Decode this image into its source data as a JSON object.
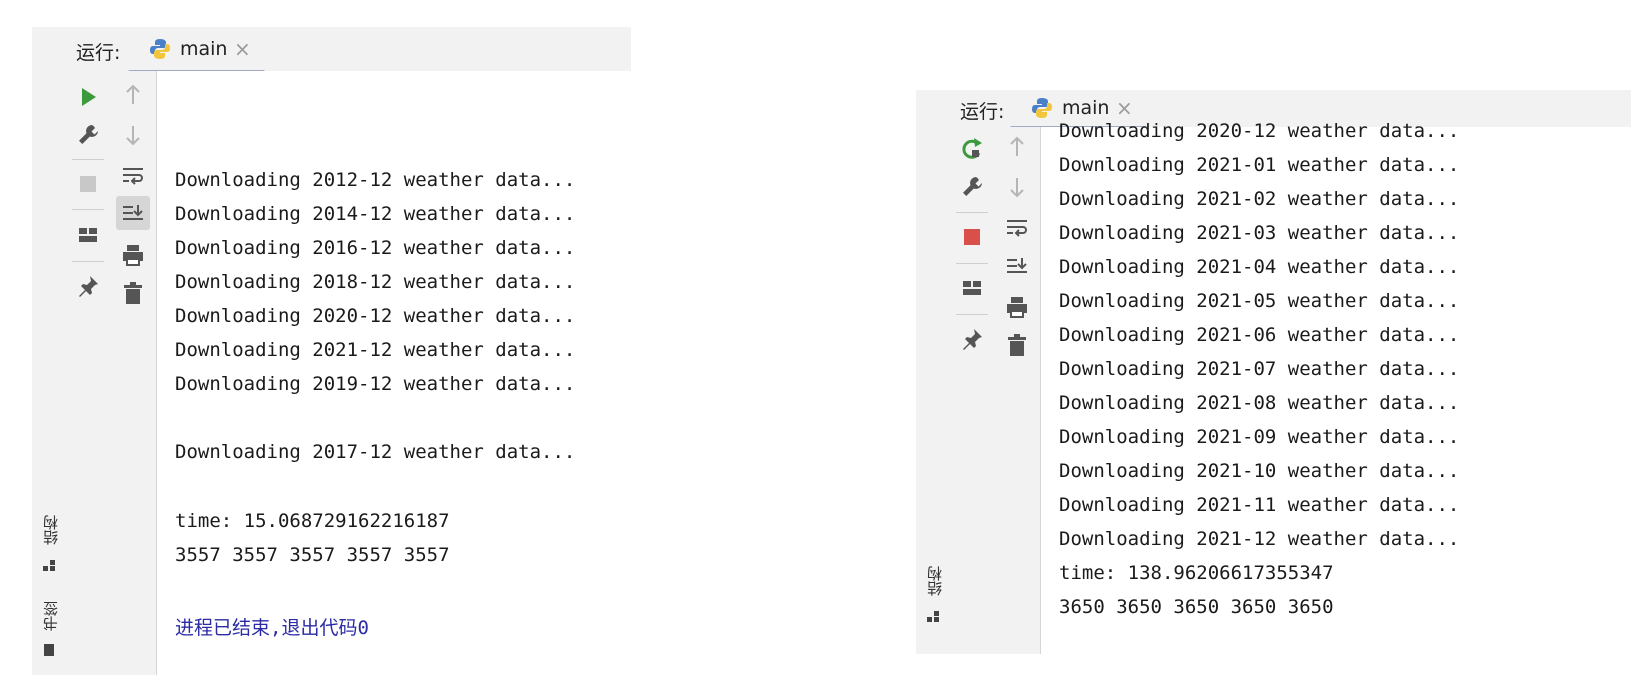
{
  "left_panel": {
    "run_label": "运行:",
    "tab_label": "main",
    "tab_close": "×",
    "side_labels": {
      "structure": "结构",
      "bookmarks": "书签"
    },
    "console_lines": [
      "Downloading 2012-12 weather data...",
      "Downloading 2014-12 weather data...",
      "Downloading 2016-12 weather data...",
      "Downloading 2018-12 weather data...",
      "Downloading 2020-12 weather data...",
      "Downloading 2021-12 weather data...",
      "Downloading 2019-12 weather data...",
      "",
      "Downloading 2017-12 weather data...",
      "",
      "time: 15.068729162216187",
      "3557 3557 3557 3557 3557",
      "",
      "进程已结束,退出代码0"
    ],
    "toolbar_icons": [
      "run-icon",
      "wrench-icon",
      "stop-icon",
      "layout-icon",
      "pin-icon"
    ],
    "toolbar2_icons": [
      "arrow-up-icon",
      "arrow-down-icon",
      "soft-wrap-icon",
      "scroll-to-end-icon",
      "print-icon",
      "trash-icon"
    ]
  },
  "right_panel": {
    "run_label": "运行:",
    "tab_label": "main",
    "tab_close": "×",
    "side_labels": {
      "structure": "结构"
    },
    "console_lines": [
      "Downloading 2020-12 weather data...",
      "Downloading 2021-01 weather data...",
      "Downloading 2021-02 weather data...",
      "Downloading 2021-03 weather data...",
      "Downloading 2021-04 weather data...",
      "Downloading 2021-05 weather data...",
      "Downloading 2021-06 weather data...",
      "Downloading 2021-07 weather data...",
      "Downloading 2021-08 weather data...",
      "Downloading 2021-09 weather data...",
      "Downloading 2021-10 weather data...",
      "Downloading 2021-11 weather data...",
      "Downloading 2021-12 weather data...",
      "time: 138.96206617355347",
      "3650 3650 3650 3650 3650"
    ],
    "toolbar_icons": [
      "rerun-icon",
      "wrench-icon",
      "stop-icon",
      "layout-icon",
      "pin-icon"
    ],
    "toolbar2_icons": [
      "arrow-up-icon",
      "arrow-down-icon",
      "soft-wrap-icon",
      "scroll-to-end-icon",
      "print-icon",
      "trash-icon"
    ]
  },
  "colors": {
    "run_green": "#3c9a3c",
    "stop_red": "#d9504a",
    "stop_gray": "#c8c8c8",
    "exit_text": "#2b2ba6"
  }
}
